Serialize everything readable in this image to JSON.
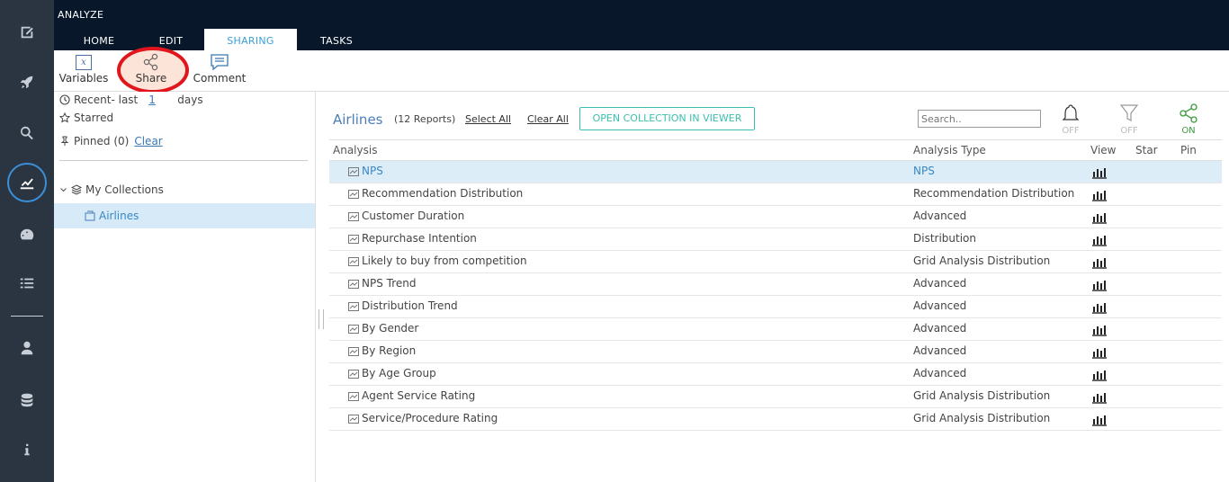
{
  "header": {
    "app_title": "ANALYZE",
    "tabs": [
      {
        "label": "HOME"
      },
      {
        "label": "EDIT"
      },
      {
        "label": "SHARING"
      },
      {
        "label": "TASKS"
      }
    ],
    "active_tab": "SHARING"
  },
  "ribbon": {
    "variables_label": "Variables",
    "variables_glyph": "x",
    "share_label": "Share",
    "comment_label": "Comment"
  },
  "left_panel": {
    "recent_label": "Recent- last",
    "recent_value": "1",
    "recent_unit": "days",
    "starred_label": "Starred",
    "pinned_label": "Pinned (0)",
    "clear_label": "Clear",
    "my_collections_label": "My Collections",
    "collection_item": "Airlines"
  },
  "main": {
    "collection_title": "Airlines",
    "reports_count": "(12 Reports)",
    "select_all": "Select All",
    "clear_all": "Clear All",
    "open_button": "OPEN COLLECTION IN VIEWER",
    "search_placeholder": "Search..",
    "toggles": [
      {
        "icon": "bell-icon",
        "label": "OFF"
      },
      {
        "icon": "filter-icon",
        "label": "OFF"
      },
      {
        "icon": "share-icon",
        "label": "ON"
      }
    ],
    "columns": [
      "Analysis",
      "Analysis Type",
      "View",
      "Star",
      "Pin"
    ],
    "rows": [
      {
        "name": "NPS",
        "type": "NPS"
      },
      {
        "name": "Recommendation Distribution",
        "type": "Recommendation Distribution"
      },
      {
        "name": "Customer Duration",
        "type": "Advanced"
      },
      {
        "name": "Repurchase Intention",
        "type": "Distribution"
      },
      {
        "name": "Likely to buy from competition",
        "type": "Grid Analysis Distribution"
      },
      {
        "name": "NPS Trend",
        "type": "Advanced"
      },
      {
        "name": "Distribution Trend",
        "type": "Advanced"
      },
      {
        "name": "By Gender",
        "type": "Advanced"
      },
      {
        "name": "By Region",
        "type": "Advanced"
      },
      {
        "name": "By Age Group",
        "type": "Advanced"
      },
      {
        "name": "Agent Service Rating",
        "type": "Grid Analysis Distribution"
      },
      {
        "name": "Service/Procedure Rating",
        "type": "Grid Analysis Distribution"
      }
    ],
    "selected_row": 0
  },
  "colors": {
    "rail_bg": "#2b3541",
    "topbar_bg": "#08182a",
    "accent": "#3aa0dc",
    "selected_row_bg": "#dcedf8",
    "teal_button": "#3bbfae",
    "toggle_on": "#3a9a3a",
    "highlight_ring": "#e0161c"
  }
}
